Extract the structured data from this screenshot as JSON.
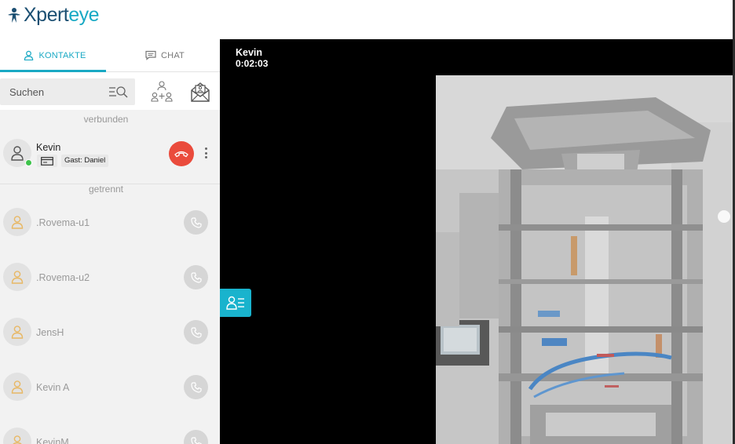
{
  "app": {
    "logo_name": "Xpert",
    "logo_accent": "eye"
  },
  "tabs": [
    {
      "label": "KONTAKTE",
      "icon": "person-icon",
      "active": true
    },
    {
      "label": "CHAT",
      "icon": "chat-bubble-icon",
      "active": false
    }
  ],
  "search": {
    "placeholder": "Suchen",
    "value": ""
  },
  "tool_icons": [
    "filter-search-icon",
    "group-add-icon",
    "mail-contact-icon"
  ],
  "sections": {
    "connected_label": "verbunden",
    "disconnected_label": "getrennt"
  },
  "active_contact": {
    "name": "Kevin",
    "guest_label": "Gast: Daniel",
    "status": "online"
  },
  "contacts": [
    {
      "name": ".Rovema-u1"
    },
    {
      "name": ".Rovema-u2"
    },
    {
      "name": "JensH"
    },
    {
      "name": "Kevin A"
    },
    {
      "name": "KevinM"
    }
  ],
  "call": {
    "caller": "Kevin",
    "timer": "0:02:03"
  },
  "colors": {
    "accent": "#19a9c4",
    "hangup": "#ea4b3c",
    "online": "#3ec34b",
    "video_bg": "#000000"
  }
}
